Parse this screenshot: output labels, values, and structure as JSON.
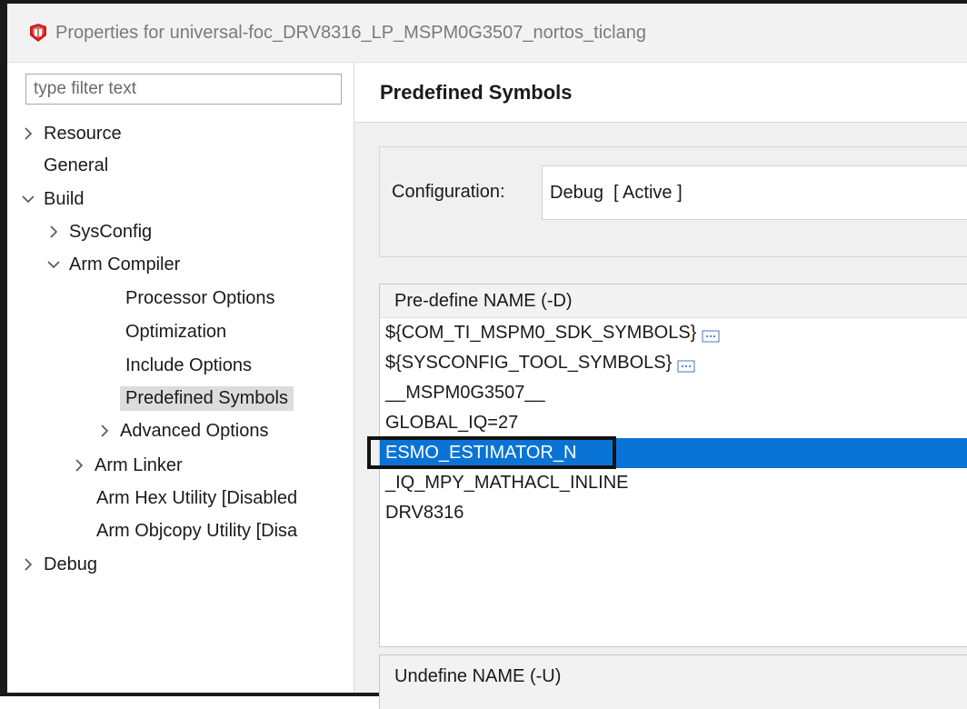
{
  "window": {
    "title": "Properties for universal-foc_DRV8316_LP_MSPM0G3507_nortos_ticlang",
    "icon": "ti-logo-icon"
  },
  "sidebar": {
    "filter_placeholder": "type filter text",
    "items": [
      {
        "label": "Resource",
        "expander": "collapsed"
      },
      {
        "label": "General",
        "expander": "none"
      },
      {
        "label": "Build",
        "expander": "expanded"
      },
      {
        "label": "SysConfig",
        "expander": "collapsed"
      },
      {
        "label": "Arm Compiler",
        "expander": "expanded"
      },
      {
        "label": "Processor Options",
        "expander": "none"
      },
      {
        "label": "Optimization",
        "expander": "none"
      },
      {
        "label": "Include Options",
        "expander": "none"
      },
      {
        "label": "Predefined Symbols",
        "expander": "none",
        "selected": true
      },
      {
        "label": "Advanced Options",
        "expander": "collapsed"
      },
      {
        "label": "Arm Linker",
        "expander": "collapsed"
      },
      {
        "label": "Arm Hex Utility  [Disabled",
        "expander": "none"
      },
      {
        "label": "Arm Objcopy Utility  [Disa",
        "expander": "none"
      },
      {
        "label": "Debug",
        "expander": "collapsed"
      }
    ]
  },
  "main": {
    "title": "Predefined Symbols",
    "configuration": {
      "label": "Configuration:",
      "value": "Debug  [ Active ]"
    },
    "predefine": {
      "header": "Pre-define NAME (-D)",
      "rows": [
        {
          "text": "${COM_TI_MSPM0_SDK_SYMBOLS}",
          "has_more": true
        },
        {
          "text": "${SYSCONFIG_TOOL_SYMBOLS}",
          "has_more": true
        },
        {
          "text": "__MSPM0G3507__",
          "has_more": false
        },
        {
          "text": "GLOBAL_IQ=27",
          "has_more": false
        },
        {
          "text": "ESMO_ESTIMATOR_N",
          "has_more": false,
          "selected": true
        },
        {
          "text": "_IQ_MPY_MATHACL_INLINE",
          "has_more": false
        },
        {
          "text": "DRV8316",
          "has_more": false
        }
      ]
    },
    "undefine": {
      "header": "Undefine NAME (-U)"
    }
  },
  "colors": {
    "selection": "#0a74d6",
    "tree_selection": "#dcdcdc",
    "logo_red": "#cc1f1f"
  }
}
